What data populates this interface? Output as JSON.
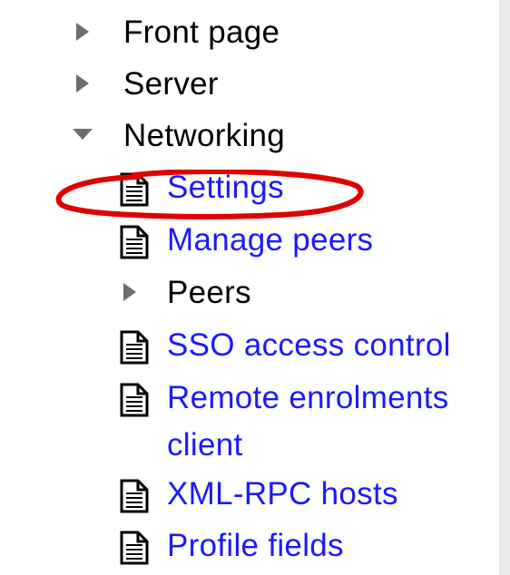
{
  "tree": {
    "items": [
      {
        "label": "Front page",
        "type": "collapsed",
        "icon": "triangle-right-icon"
      },
      {
        "label": "Server",
        "type": "collapsed",
        "icon": "triangle-right-icon"
      },
      {
        "label": "Networking",
        "type": "expanded",
        "icon": "triangle-down-icon"
      },
      {
        "label": "Settings",
        "type": "link",
        "icon": "page-icon",
        "highlighted": true
      },
      {
        "label": "Manage peers",
        "type": "link",
        "icon": "page-icon"
      },
      {
        "label": "Peers",
        "type": "collapsed",
        "icon": "triangle-right-icon"
      },
      {
        "label": "SSO access control",
        "type": "link",
        "icon": "page-icon"
      },
      {
        "label_line1": "Remote enrolments",
        "label_line2": "client",
        "type": "link",
        "icon": "page-icon"
      },
      {
        "label": "XML-RPC hosts",
        "type": "link",
        "icon": "page-icon"
      },
      {
        "label": "Profile fields",
        "type": "link",
        "icon": "page-icon"
      }
    ]
  },
  "colors": {
    "link": "#1a1aff",
    "text": "#000000",
    "arrow": "#707070",
    "highlight": "#e00000"
  }
}
